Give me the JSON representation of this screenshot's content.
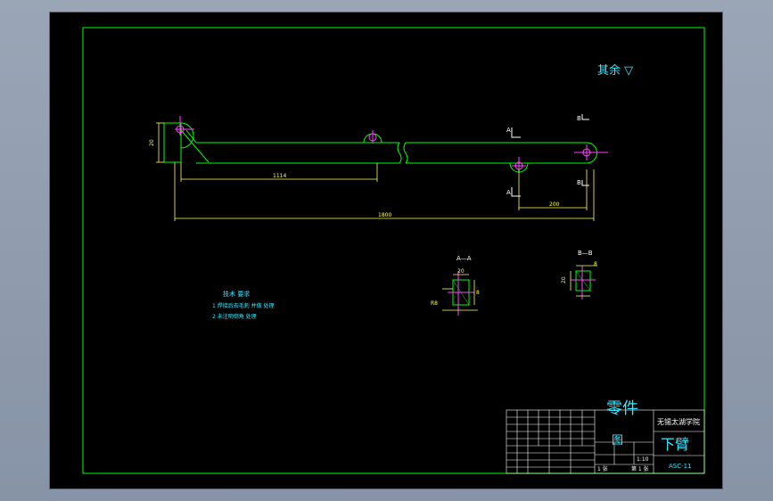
{
  "colors": {
    "frame": "#00ff00",
    "part": "#00ff00",
    "dimension": "#ffff55",
    "text": "#38e8ff",
    "center": "#ff40ff",
    "cut": "#ffffff"
  },
  "roughness_note": "其余 ▽",
  "dimensions": {
    "left_height": "20",
    "inner_length": "1114",
    "total_length": "1800",
    "right_offset": "200",
    "sec_a_top": "20",
    "sec_a_right": "8",
    "sec_a_left": "R8",
    "sec_b_left": "20",
    "sec_b_top": "8"
  },
  "section_labels": {
    "section_a": "A—A",
    "section_b": "B—B",
    "cut_a_top": "A",
    "cut_a_bottom": "A",
    "cut_b_top": "B",
    "cut_b_bottom": "B"
  },
  "tech_requirements": {
    "title": "技术 要求",
    "items": [
      "1  焊接后去毛刺 并做 处理",
      "2  未注明倒角 处理"
    ]
  },
  "title_block": {
    "part_label": "零件",
    "drawing_label": "图",
    "school": "无锡太湖学院",
    "part_name": "下臂",
    "drawing_no": "ASC-11",
    "scale": "1:10",
    "sheet_left": "1 张",
    "sheet_right": "第 1 张"
  }
}
